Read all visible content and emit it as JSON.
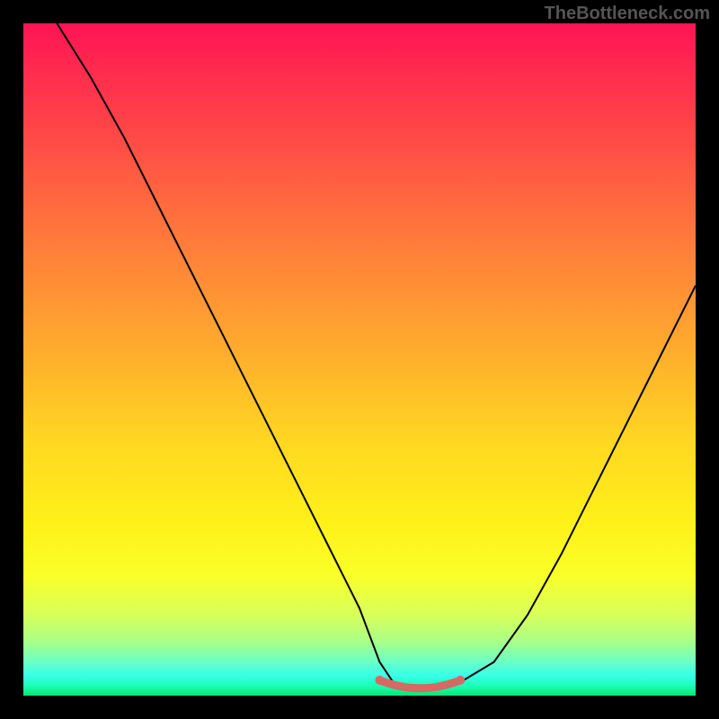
{
  "watermark": "TheBottleneck.com",
  "chart_data": {
    "type": "line",
    "title": "",
    "xlabel": "",
    "ylabel": "",
    "xlim": [
      0,
      100
    ],
    "ylim": [
      0,
      100
    ],
    "series": [
      {
        "name": "curve",
        "x": [
          5,
          10,
          15,
          20,
          25,
          30,
          35,
          40,
          45,
          50,
          53,
          55,
          58,
          62,
          65,
          70,
          75,
          80,
          85,
          90,
          95,
          100
        ],
        "values": [
          100,
          92,
          83,
          73,
          63,
          53,
          43,
          33,
          23,
          13,
          5,
          2,
          1,
          1,
          2,
          5,
          12,
          21,
          31,
          41,
          51,
          61
        ]
      }
    ],
    "annotations": {
      "trough_marker": {
        "x_range": [
          53,
          65
        ],
        "y": 1.5,
        "color": "#d66a63"
      }
    },
    "background_gradient": {
      "top_color": "#ff1453",
      "bottom_color": "#06e873"
    }
  }
}
